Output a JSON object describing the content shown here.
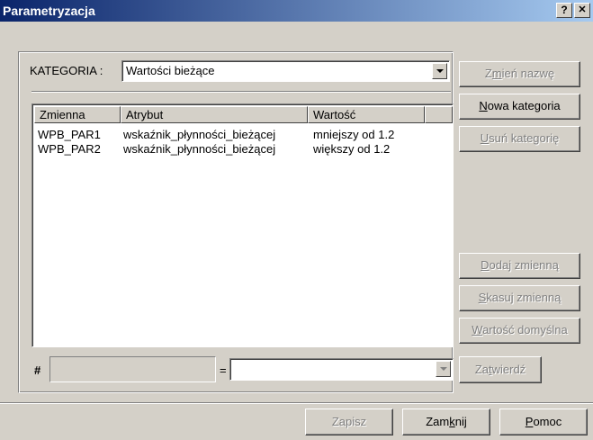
{
  "window": {
    "title": "Parametryzacja",
    "help_label": "?",
    "close_label": "✕"
  },
  "category": {
    "label": "KATEGORIA :",
    "selected": "Wartości bieżące"
  },
  "table": {
    "columns": [
      "Zmienna",
      "Atrybut",
      "Wartość",
      ""
    ],
    "rows": [
      [
        "WPB_PAR1",
        "wskaźnik_płynności_bieżącej",
        "mniejszy od 1.2"
      ],
      [
        "WPB_PAR2",
        "wskaźnik_płynności_bieżącej",
        "większy od 1.2"
      ]
    ]
  },
  "side_buttons": {
    "rename": {
      "pre": "Z",
      "acc": "m",
      "post": "ień nazwę"
    },
    "new_category": {
      "pre": "",
      "acc": "N",
      "post": "owa kategoria"
    },
    "delete_category": {
      "pre": "",
      "acc": "U",
      "post": "suń kategorię"
    },
    "add_variable": {
      "pre": "",
      "acc": "D",
      "post": "odaj zmienną"
    },
    "delete_variable": {
      "pre": "",
      "acc": "S",
      "post": "kasuj zmienną"
    },
    "default_value": {
      "pre": "",
      "acc": "W",
      "post": "artość domyślna"
    },
    "confirm": {
      "pre": "Za",
      "acc": "t",
      "post": "wierdź"
    }
  },
  "editor": {
    "hash_label": "#",
    "equals_label": "="
  },
  "bottom_buttons": {
    "save": "Zapisz",
    "close": {
      "pre": "Zam",
      "acc": "k",
      "post": "nij"
    },
    "help": {
      "pre": "",
      "acc": "P",
      "post": "omoc"
    }
  }
}
